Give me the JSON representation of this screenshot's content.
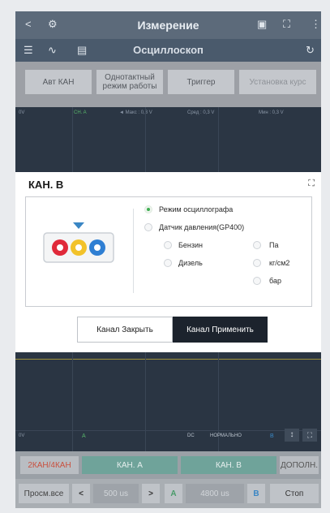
{
  "header": {
    "title": "Измерение",
    "subtitle": "Осциллоскоп"
  },
  "toolbar_tabs": [
    {
      "label": "Авт КАН"
    },
    {
      "label": "Однотактный режим работы"
    },
    {
      "label": "Триггер"
    },
    {
      "label": "Установка курс"
    }
  ],
  "scope_top": {
    "labels": [
      "0V",
      "CH. A",
      "◄ Макс : 0,3 V",
      "Сред : 0,3 V",
      "Мин : 0,3 V"
    ]
  },
  "dialog": {
    "title": "КАН. B",
    "mode_option": "Режим осциллографа",
    "pressure_option": "Датчик давления(GP400)",
    "fuel_options": [
      "Бензин",
      "Дизель"
    ],
    "unit_options": [
      "Па",
      "кг/см2",
      "бар"
    ],
    "close_button": "Канал Закрыть",
    "apply_button": "Канал Применить",
    "colors": {
      "red": "#e0293a",
      "yellow": "#f2c22a",
      "blue": "#2f7fd3",
      "triangle": "#3a86c4"
    }
  },
  "scope_bottom": {
    "left_label": "0V",
    "a_label": "A",
    "dc_label": "DC",
    "mode_label": "НОРМАЛЬНО",
    "b_label": "B"
  },
  "bottom_bar": {
    "channel_mode": "2КАН/4КАН",
    "ch_a": "КАН. A",
    "ch_b": "КАН. B",
    "more": "ДОПОЛН.",
    "view_all": "Просм.все",
    "time_value": "500 us",
    "a_badge": "A",
    "sample_value": "4800 us",
    "b_badge": "B",
    "stop": "Стоп"
  }
}
